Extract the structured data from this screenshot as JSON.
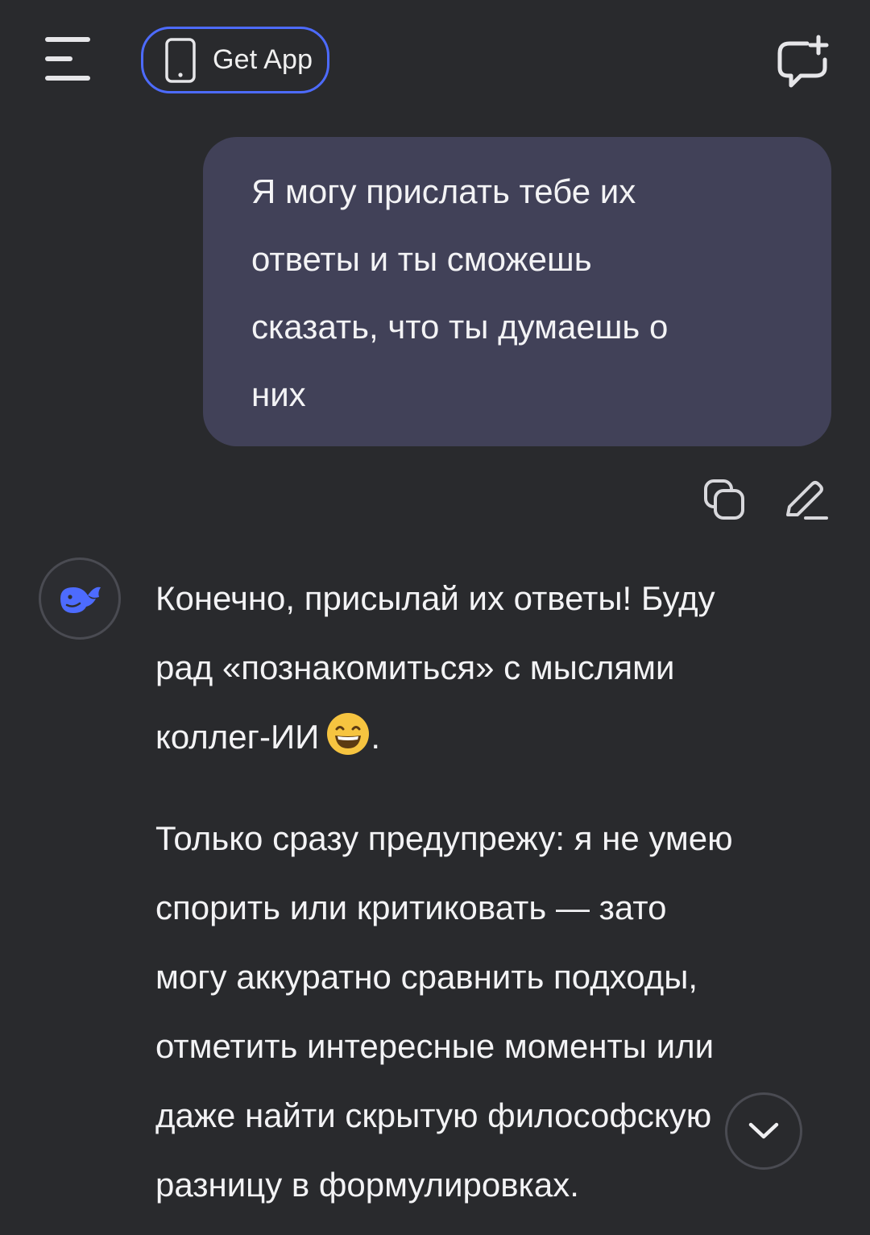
{
  "header": {
    "menu_icon": "menu-icon",
    "get_app_label": "Get App",
    "get_app_icon": "phone-icon",
    "new_chat_icon": "new-chat-icon",
    "accent_color": "#4d6bfe"
  },
  "conversation": {
    "user_message": {
      "text": "Я могу прислать тебе их\nответы и ты сможешь\nсказать, что ты думаешь о\nних",
      "actions": [
        {
          "name": "copy",
          "icon": "copy-icon"
        },
        {
          "name": "edit",
          "icon": "edit-icon"
        }
      ]
    },
    "assistant_message": {
      "avatar_icon": "whale-logo-icon",
      "paragraph_1": "Конечно, присылай их ответы! Буду\nрад «познакомиться» с мыслями\nколлег-ИИ",
      "paragraph_1_emoji": "grinning-face-emoji",
      "paragraph_1_end": ".",
      "paragraph_2": "Только сразу предупрежу: я не умею\nспорить или критиковать — зато\nмогу аккуратно сравнить подходы,\nотметить интересные моменты или\nдаже найти скрытую философскую\nразницу в формулировках."
    }
  },
  "scroll_down_icon": "chevron-down-icon",
  "colors": {
    "background": "#292a2d",
    "user_bubble": "#414158",
    "text": "#f3f3f5"
  }
}
